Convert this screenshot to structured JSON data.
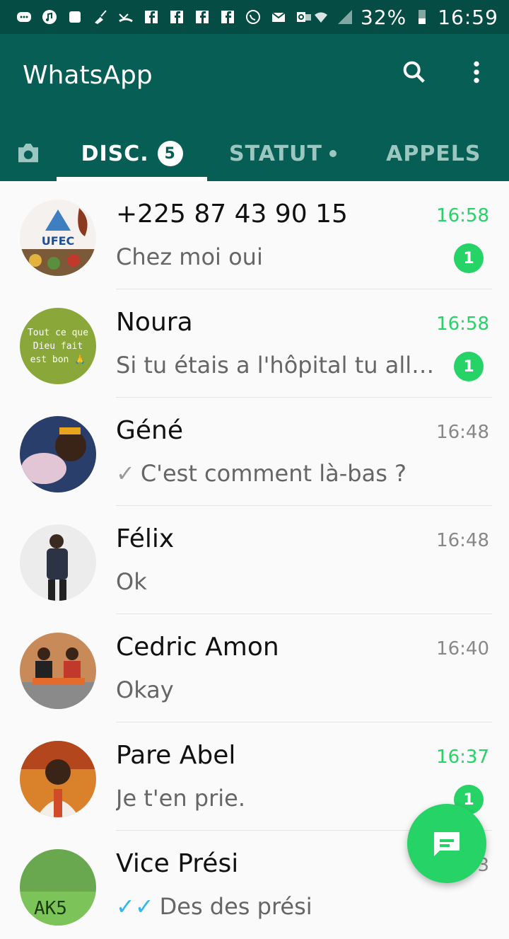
{
  "status_bar": {
    "battery": "32%",
    "time": "16:59",
    "icons": [
      "chat-bubble-icon",
      "music-icon",
      "app-icon",
      "broom-icon",
      "missed-call-icon",
      "facebook-icon",
      "facebook-icon",
      "facebook-icon",
      "facebook-icon",
      "whatsapp-icon",
      "email-icon",
      "outlook-icon",
      "wifi-icon",
      "signal-icon",
      "battery-icon"
    ]
  },
  "header": {
    "title": "WhatsApp",
    "search_icon": "search-icon",
    "menu_icon": "more-vert-icon"
  },
  "tabs": [
    {
      "label": "DISC.",
      "badge": "5",
      "active": true
    },
    {
      "label": "STATUT",
      "dot": true,
      "active": false
    },
    {
      "label": "APPELS",
      "active": false
    }
  ],
  "chats": [
    {
      "name": "+225 87 43 90 15",
      "preview": "Chez moi oui",
      "time": "16:58",
      "unread": "1",
      "avatar_text": "UFEC"
    },
    {
      "name": "Noura",
      "preview": "Si tu étais a l'hôpital tu allai...",
      "time": "16:58",
      "unread": "1",
      "avatar_text": "Tout ce que Dieu fait est bon 🙏"
    },
    {
      "name": "Géné",
      "preview": "C'est comment là-bas ?",
      "time": "16:48",
      "tick": "✓"
    },
    {
      "name": "Félix",
      "preview": "Ok",
      "time": "16:48"
    },
    {
      "name": "Cedric Amon",
      "preview": "Okay",
      "time": "16:40"
    },
    {
      "name": "Pare Abel",
      "preview": "Je t'en prie.",
      "time": "16:37",
      "unread": "1"
    },
    {
      "name": "Vice Prési",
      "preview": "Des des prési",
      "time": "16:33",
      "tick": "✓✓",
      "avatar_text": "AK5"
    }
  ],
  "colors": {
    "primary": "#075e54",
    "status_bar": "#054d44",
    "accent": "#25d366"
  }
}
